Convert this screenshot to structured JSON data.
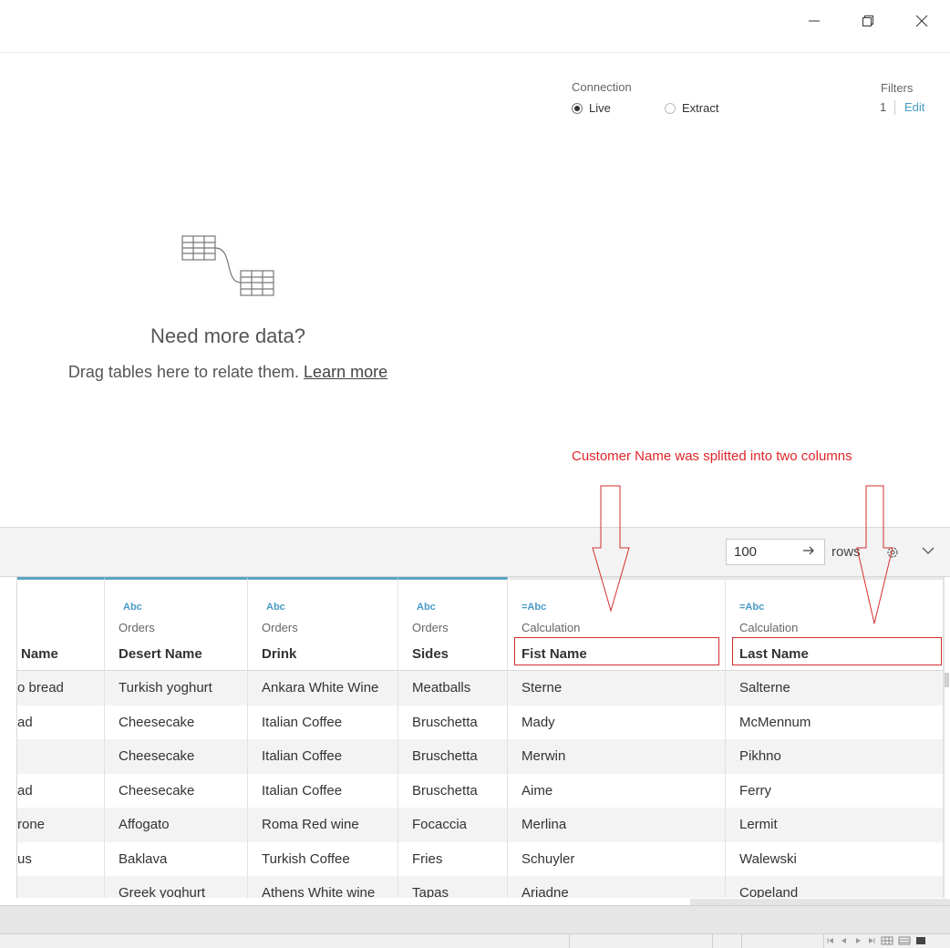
{
  "window": {
    "minimize_icon": "minimize-icon",
    "maximize_icon": "restore-icon",
    "close_icon": "close-icon"
  },
  "connection": {
    "label": "Connection",
    "live_label": "Live",
    "extract_label": "Extract",
    "selected": "Live"
  },
  "filters": {
    "label": "Filters",
    "count": "1",
    "edit_label": "Edit"
  },
  "canvas": {
    "heading": "Need more data?",
    "message": "Drag tables here to relate them.",
    "learn_more": "Learn more"
  },
  "annotation": {
    "text": "Customer Name was splitted into two columns",
    "color": "#e0252a"
  },
  "toolbar": {
    "rows_value": "100",
    "rows_label": "rows"
  },
  "grid": {
    "columns": [
      {
        "type": "",
        "source": "",
        "name": "Name"
      },
      {
        "type": "Abc",
        "source": "Orders",
        "name": "Desert Name"
      },
      {
        "type": "Abc",
        "source": "Orders",
        "name": "Drink"
      },
      {
        "type": "Abc",
        "source": "Orders",
        "name": "Sides"
      },
      {
        "type": "=Abc",
        "source": "Calculation",
        "name": "Fist Name"
      },
      {
        "type": "=Abc",
        "source": "Calculation",
        "name": "Last Name"
      }
    ],
    "rows": [
      [
        "o bread",
        "Turkish yoghurt",
        "Ankara White Wine",
        "Meatballs",
        "Sterne",
        "Salterne"
      ],
      [
        "ad",
        "Cheesecake",
        "Italian Coffee",
        "Bruschetta",
        "Mady",
        "McMennum"
      ],
      [
        "",
        "Cheesecake",
        "Italian Coffee",
        "Bruschetta",
        "Merwin",
        "Pikhno"
      ],
      [
        "ad",
        "Cheesecake",
        "Italian Coffee",
        "Bruschetta",
        "Aime",
        "Ferry"
      ],
      [
        "rone",
        "Affogato",
        "Roma Red wine",
        "Focaccia",
        "Merlina",
        "Lermit"
      ],
      [
        "us",
        "Baklava",
        "Turkish Coffee",
        "Fries",
        "Schuyler",
        "Walewski"
      ],
      [
        "",
        "Greek yoghurt",
        "Athens White wine",
        "Tapas",
        "Ariadne",
        "Copeland"
      ]
    ]
  },
  "colors": {
    "accent": "#4a9bc7",
    "highlight": "#d32f2f",
    "header_bar": "#5ba4c4"
  }
}
